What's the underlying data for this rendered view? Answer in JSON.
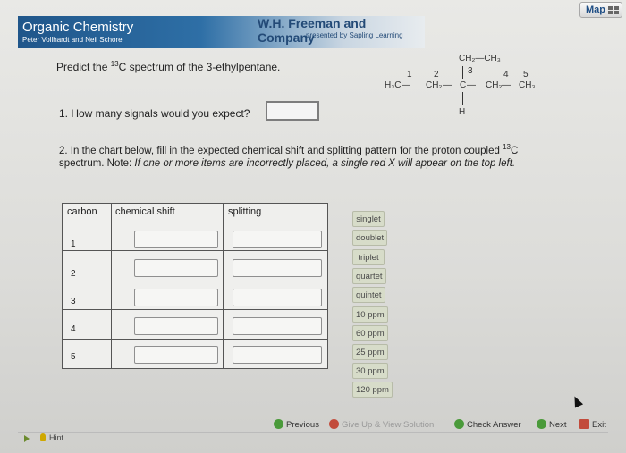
{
  "header": {
    "course_title": "Organic Chemistry",
    "course_authors": "Peter Vollhardt and Neil Schore",
    "publisher": "W.H. Freeman and Company",
    "presented_by": "presented by Sapling Learning",
    "map_label": "Map"
  },
  "question": {
    "prompt_pre": "Predict the ",
    "prompt_sup": "13",
    "prompt_post": "C spectrum of the 3-ethylpentane.",
    "q1": "1. How many signals would you expect?",
    "q1_answer": "",
    "q2_line1": "2. In the chart below, fill in the expected chemical shift and splitting pattern for the proton coupled ",
    "q2_sup": "13",
    "q2_c": "C",
    "q2_line2": "spectrum. Note: ",
    "q2_note": "If one or more items are incorrectly placed, a single red X will appear on the top left."
  },
  "molecule": {
    "top": "CH₂—CH₃",
    "n1": "1",
    "n2": "2",
    "n3": "3",
    "n4": "4",
    "n5": "5",
    "c1": "H₃C",
    "c2": "CH₂",
    "c3": "C",
    "c4": "CH₂",
    "c5": "CH₃",
    "h": "H",
    "bond": "—"
  },
  "table": {
    "headers": [
      "carbon",
      "chemical shift",
      "splitting"
    ],
    "rows": [
      "1",
      "2",
      "3",
      "4",
      "5"
    ]
  },
  "tiles": [
    "singlet",
    "doublet",
    "triplet",
    "quartet",
    "quintet",
    "10 ppm",
    "60 ppm",
    "25 ppm",
    "30 ppm",
    "120 ppm"
  ],
  "nav": {
    "previous": "Previous",
    "giveup": "Give Up & View Solution",
    "check": "Check Answer",
    "next": "Next",
    "exit": "Exit",
    "hint": "Hint"
  }
}
